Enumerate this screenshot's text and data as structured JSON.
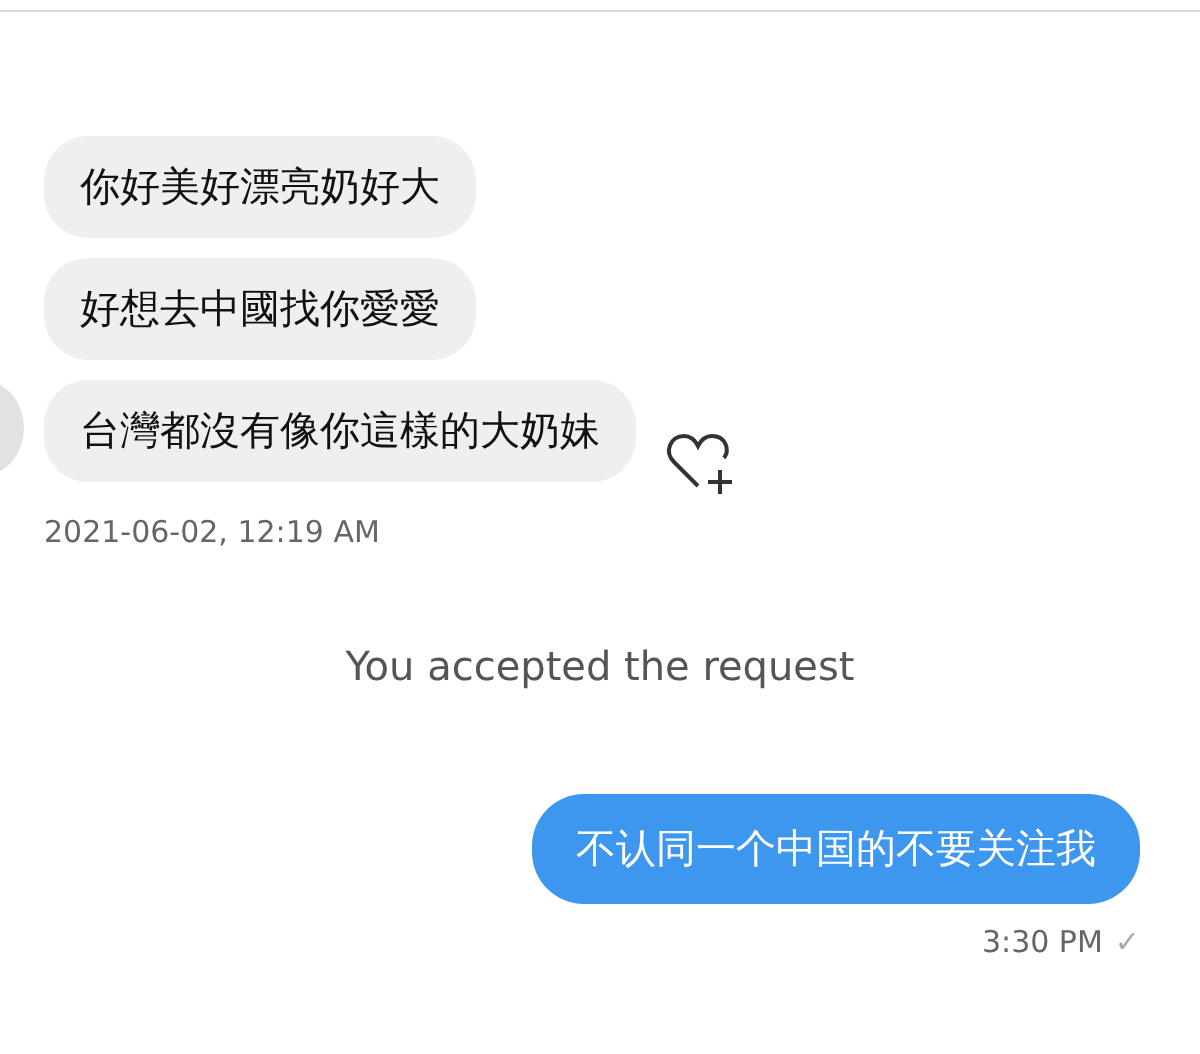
{
  "incoming_messages": [
    {
      "text": "你好美好漂亮奶好大"
    },
    {
      "text": "好想去中國找你愛愛"
    },
    {
      "text": "台灣都沒有像你這樣的大奶妹"
    }
  ],
  "incoming_time": "2021-06-02, 12:19 AM",
  "system_notice": "You accepted the request",
  "outgoing_message": {
    "text": "不认同一个中国的不要关注我",
    "time": "3:30 PM",
    "status": "✓"
  }
}
